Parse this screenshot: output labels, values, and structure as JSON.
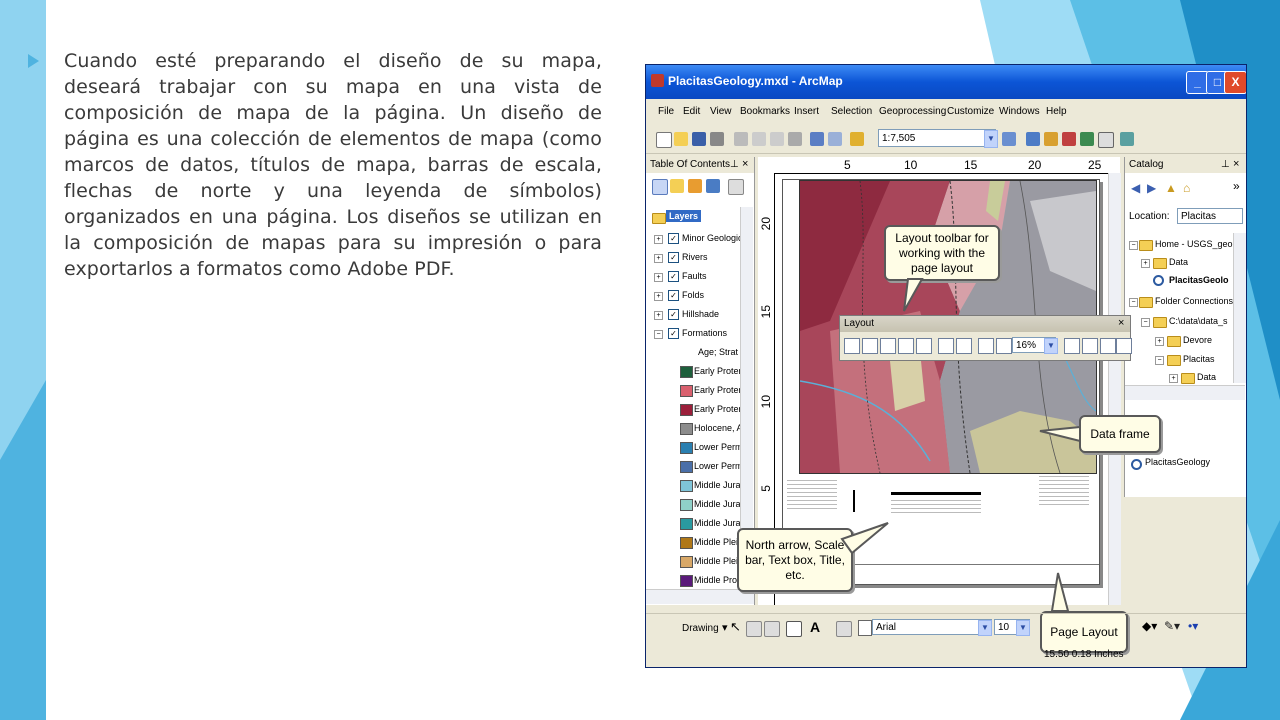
{
  "slide": {
    "bullet_text": "Cuando esté preparando el diseño de su mapa, deseará trabajar con su mapa en una vista de composición de mapa de la página. Un diseño de página es una colección de elementos de mapa (como marcos de datos, títulos de mapa, barras de escala, flechas de norte y una leyenda de símbolos) organizados en una página. Los diseños se utilizan en la composición de mapas para su impresión o para exportarlos a formatos como Adobe PDF.",
    "accent_color": "#4fb3e0"
  },
  "window": {
    "title": "PlacitasGeology.mxd - ArcMap",
    "controls": {
      "minimize": "_",
      "maximize": "□",
      "close": "X"
    }
  },
  "menubar": {
    "items": [
      "File",
      "Edit",
      "View",
      "Bookmarks",
      "Insert",
      "Selection",
      "Geoprocessing",
      "Customize",
      "Windows",
      "Help"
    ]
  },
  "toolbar": {
    "scale_value": "1:7,505"
  },
  "toc": {
    "title": "Table Of Contents",
    "root": "Layers",
    "layers": [
      "Minor Geologic",
      "Rivers",
      "Faults",
      "Folds",
      "Hillshade",
      "Formations"
    ],
    "sublabel": "Age; Strat",
    "legend": [
      {
        "label": "Early Proter",
        "color": "#1e5f3c"
      },
      {
        "label": "Early Proter",
        "color": "#d9606e"
      },
      {
        "label": "Early Proter",
        "color": "#9b1f3a"
      },
      {
        "label": "Holocene, A",
        "color": "#8c8c8c"
      },
      {
        "label": "Lower Perm",
        "color": "#2a7fb0"
      },
      {
        "label": "Lower Perm",
        "color": "#4a6fa8"
      },
      {
        "label": "Middle Jura",
        "color": "#7fc4d8"
      },
      {
        "label": "Middle Jura",
        "color": "#8fd0c8"
      },
      {
        "label": "Middle Jura",
        "color": "#2a9aa0"
      },
      {
        "label": "Middle Pleis",
        "color": "#b07818"
      },
      {
        "label": "Middle Pleis",
        "color": "#d8a868"
      },
      {
        "label": "Middle Prote",
        "color": "#5a1a7a"
      }
    ]
  },
  "layout_view": {
    "ruler_h": [
      "5",
      "10",
      "15",
      "20",
      "25"
    ],
    "ruler_v": [
      "20",
      "15",
      "10",
      "5"
    ]
  },
  "catalog": {
    "title": "Catalog",
    "location_label": "Location:",
    "location_value": "Placitas",
    "tree": [
      "Home - USGS_geolo",
      "Data",
      "PlacitasGeolo",
      "Folder Connections",
      "C:\\data\\data_s",
      "Devore",
      "Placitas",
      "Data"
    ],
    "bottom_item": "PlacitasGeology"
  },
  "layout_toolbar": {
    "title": "Layout",
    "zoom_value": "16%"
  },
  "callouts": {
    "layout_toolbar": "Layout toolbar for working with the page layout",
    "data_frame": "Data frame",
    "north_arrow": "North arrow, Scale bar, Text box, Title, etc.",
    "page_layout": "Page Layout"
  },
  "drawing_toolbar": {
    "drawing_label": "Drawing",
    "font_name": "Arial",
    "font_size": "10"
  },
  "statusbar": {
    "coords": "15.50  0.18 Inches"
  }
}
